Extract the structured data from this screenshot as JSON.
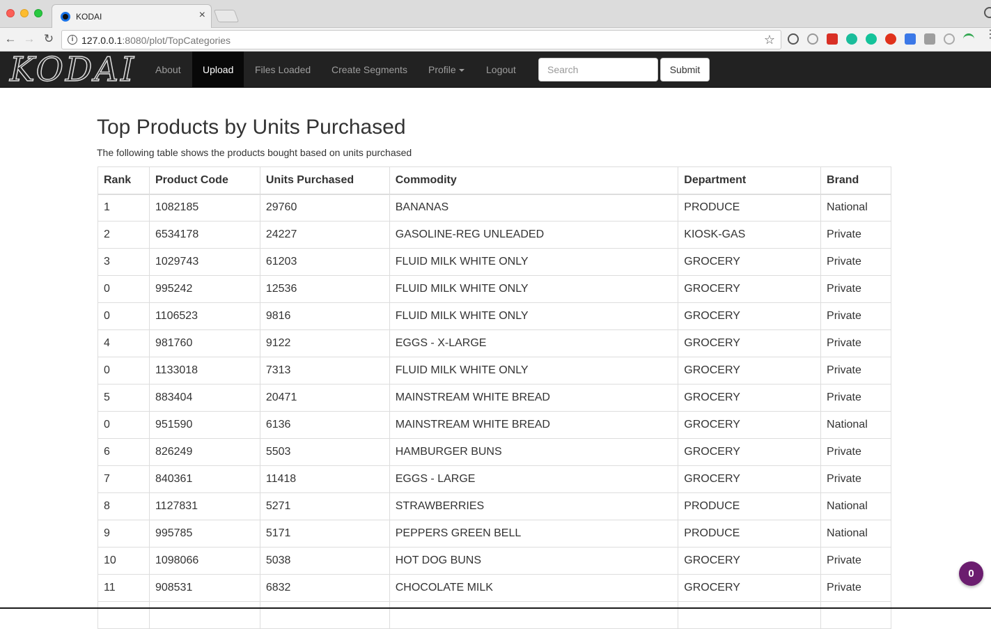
{
  "browser": {
    "tab_title": "KODAI",
    "url_host": "127.0.0.1",
    "url_rest": ":8080/plot/TopCategories"
  },
  "navbar": {
    "brand": "KODAI",
    "items": [
      {
        "label": "About"
      },
      {
        "label": "Upload",
        "active": true
      },
      {
        "label": "Files Loaded"
      },
      {
        "label": "Create Segments"
      },
      {
        "label": "Profile"
      },
      {
        "label": "Logout"
      }
    ],
    "search_placeholder": "Search",
    "submit_label": "Submit"
  },
  "main": {
    "title": "Top Products by Units Purchased",
    "description": "The following table shows the products bought based on units purchased"
  },
  "table": {
    "headers": [
      "Rank",
      "Product Code",
      "Units Purchased",
      "Commodity",
      "Department",
      "Brand"
    ],
    "rows": [
      [
        "1",
        "1082185",
        "29760",
        "BANANAS",
        "PRODUCE",
        "National"
      ],
      [
        "2",
        "6534178",
        "24227",
        "GASOLINE-REG UNLEADED",
        "KIOSK-GAS",
        "Private"
      ],
      [
        "3",
        "1029743",
        "61203",
        "FLUID MILK WHITE ONLY",
        "GROCERY",
        "Private"
      ],
      [
        "0",
        "995242",
        "12536",
        "FLUID MILK WHITE ONLY",
        "GROCERY",
        "Private"
      ],
      [
        "0",
        "1106523",
        "9816",
        "FLUID MILK WHITE ONLY",
        "GROCERY",
        "Private"
      ],
      [
        "4",
        "981760",
        "9122",
        "EGGS - X-LARGE",
        "GROCERY",
        "Private"
      ],
      [
        "0",
        "1133018",
        "7313",
        "FLUID MILK WHITE ONLY",
        "GROCERY",
        "Private"
      ],
      [
        "5",
        "883404",
        "20471",
        "MAINSTREAM WHITE BREAD",
        "GROCERY",
        "Private"
      ],
      [
        "0",
        "951590",
        "6136",
        "MAINSTREAM WHITE BREAD",
        "GROCERY",
        "National"
      ],
      [
        "6",
        "826249",
        "5503",
        "HAMBURGER BUNS",
        "GROCERY",
        "Private"
      ],
      [
        "7",
        "840361",
        "11418",
        "EGGS - LARGE",
        "GROCERY",
        "Private"
      ],
      [
        "8",
        "1127831",
        "5271",
        "STRAWBERRIES",
        "PRODUCE",
        "National"
      ],
      [
        "9",
        "995785",
        "5171",
        "PEPPERS GREEN BELL",
        "PRODUCE",
        "National"
      ],
      [
        "10",
        "1098066",
        "5038",
        "HOT DOG BUNS",
        "GROCERY",
        "Private"
      ],
      [
        "11",
        "908531",
        "6832",
        "CHOCOLATE MILK",
        "GROCERY",
        "Private"
      ],
      [
        "",
        "",
        "",
        "",
        "",
        ""
      ]
    ]
  },
  "chat_badge": {
    "count": "0"
  }
}
